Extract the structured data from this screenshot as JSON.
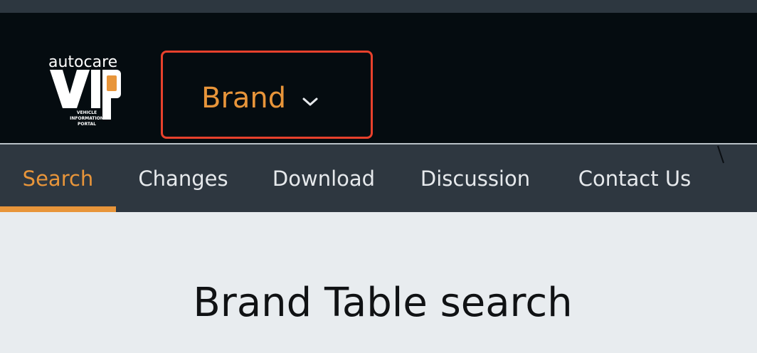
{
  "header": {
    "logo": {
      "wordmark_top": "autocare",
      "wordmark_main": "VIP",
      "tagline_lines": [
        "VEHICLE",
        "INFORMATION",
        "PORTAL"
      ],
      "accent_color": "#e8953a"
    },
    "dropdown": {
      "label": "Brand",
      "icon": "chevron-down-icon",
      "label_color": "#e8953a",
      "highlight_color": "#e8412c"
    }
  },
  "nav": {
    "tabs": [
      {
        "label": "Search",
        "active": true
      },
      {
        "label": "Changes",
        "active": false
      },
      {
        "label": "Download",
        "active": false
      },
      {
        "label": "Discussion",
        "active": false
      },
      {
        "label": "Contact Us",
        "active": false
      }
    ],
    "active_color": "#e8953a",
    "background": "#2e3740"
  },
  "main": {
    "title": "Brand Table search"
  }
}
